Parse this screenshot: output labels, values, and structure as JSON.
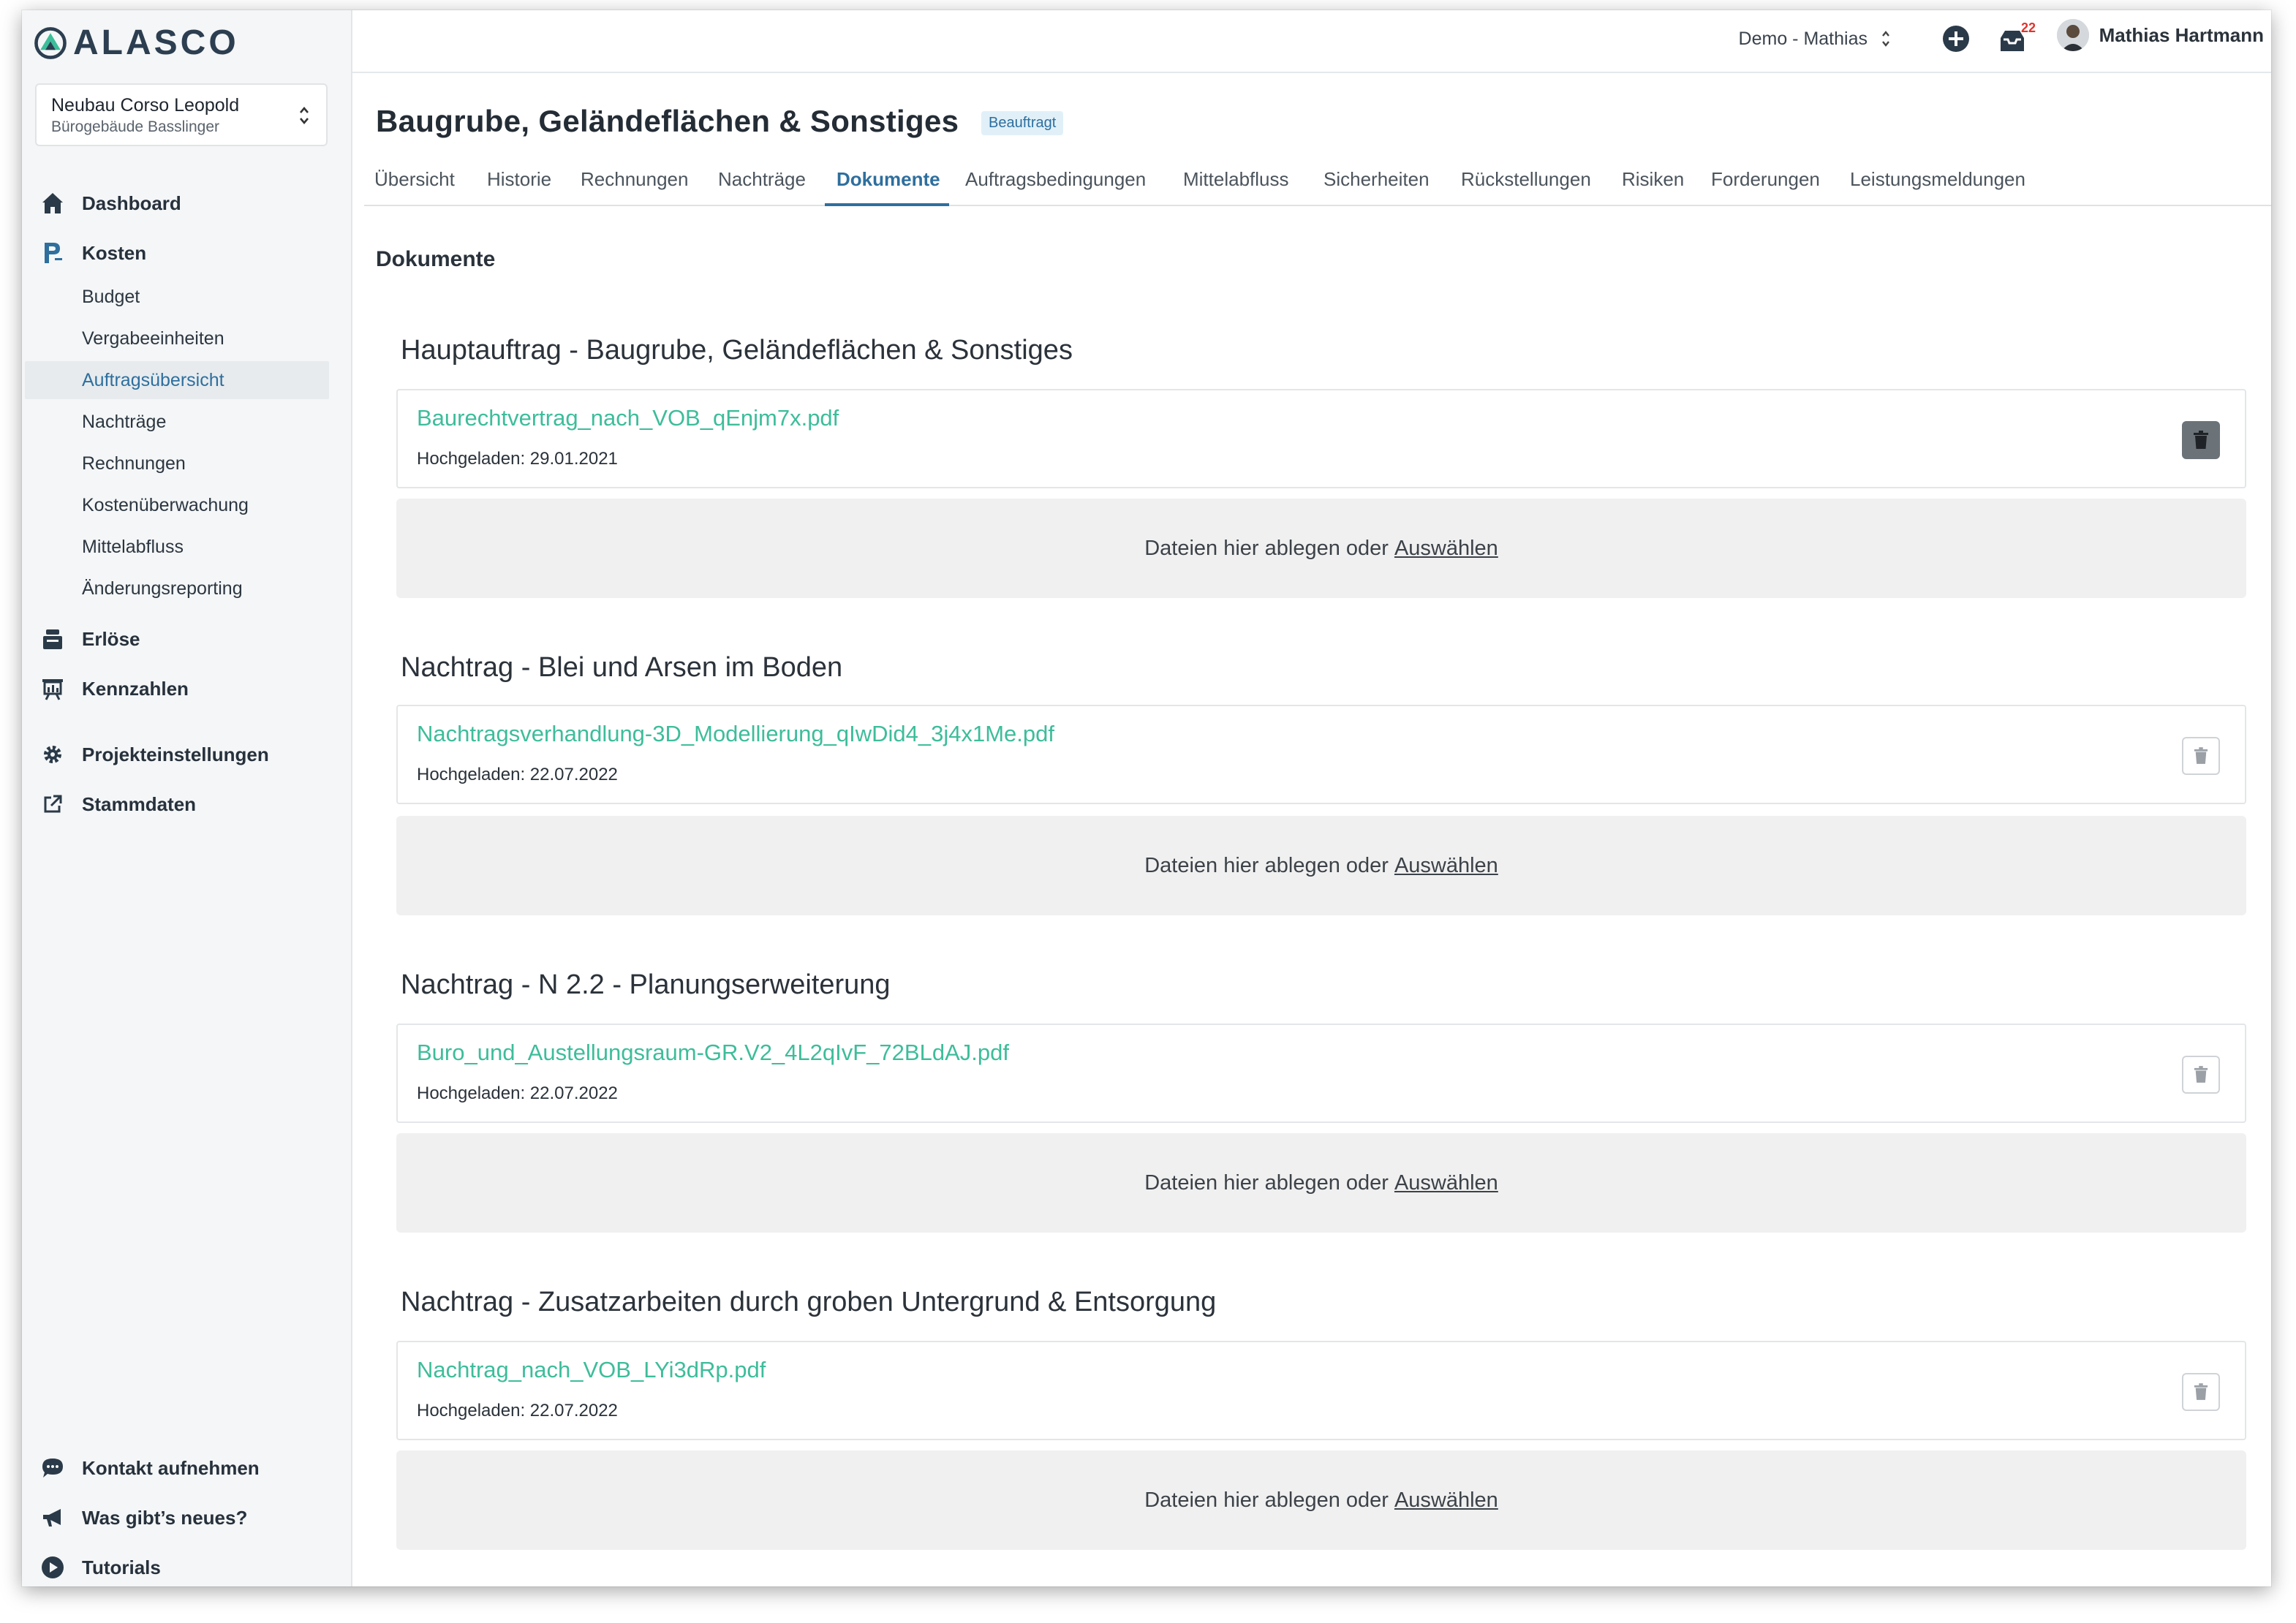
{
  "app": {
    "logo_text": "ALASCO"
  },
  "project": {
    "name": "Neubau Corso Leopold",
    "subtitle": "Bürogebäude Basslinger"
  },
  "sidebar": {
    "nav": [
      {
        "label": "Dashboard",
        "icon": "home-icon"
      },
      {
        "label": "Kosten",
        "icon": "cost-icon"
      },
      {
        "label": "Erlöse",
        "icon": "revenue-icon"
      },
      {
        "label": "Kennzahlen",
        "icon": "chart-icon"
      },
      {
        "label": "Projekteinstellungen",
        "icon": "gear-icon"
      },
      {
        "label": "Stammdaten",
        "icon": "external-link-icon"
      }
    ],
    "cost_sub": [
      {
        "label": "Budget"
      },
      {
        "label": "Vergabeeinheiten"
      },
      {
        "label": "Auftragsübersicht",
        "active": true
      },
      {
        "label": "Nachträge"
      },
      {
        "label": "Rechnungen"
      },
      {
        "label": "Kostenüberwachung"
      },
      {
        "label": "Mittelabfluss"
      },
      {
        "label": "Änderungsreporting"
      }
    ],
    "bottom": [
      {
        "label": "Kontakt aufnehmen",
        "icon": "chat-icon"
      },
      {
        "label": "Was gibt’s neues?",
        "icon": "megaphone-icon"
      },
      {
        "label": "Tutorials",
        "icon": "play-icon"
      }
    ]
  },
  "topbar": {
    "demo_select": "Demo - Mathias",
    "notification_count": "22",
    "user_name": "Mathias Hartmann"
  },
  "page": {
    "title": "Baugrube, Geländeflächen & Sonstiges",
    "status": "Beauftragt",
    "section_heading": "Dokumente",
    "tabs": [
      {
        "label": "Übersicht"
      },
      {
        "label": "Historie"
      },
      {
        "label": "Rechnungen"
      },
      {
        "label": "Nachträge"
      },
      {
        "label": "Dokumente",
        "active": true
      },
      {
        "label": "Auftragsbedingungen"
      },
      {
        "label": "Mittelabfluss"
      },
      {
        "label": "Sicherheiten"
      },
      {
        "label": "Rückstellungen"
      },
      {
        "label": "Risiken"
      },
      {
        "label": "Forderungen"
      },
      {
        "label": "Leistungsmeldungen"
      }
    ],
    "dropzone": {
      "text": "Dateien hier ablegen oder",
      "link": "Auswählen"
    },
    "groups": [
      {
        "title": "Hauptauftrag - Baugrube, Geländeflächen & Sonstiges",
        "file": "Baurechtvertrag_nach_VOB_qEnjm7x.pdf",
        "uploaded": "Hochgeladen: 29.01.2021"
      },
      {
        "title": "Nachtrag - Blei und Arsen im Boden",
        "file": "Nachtragsverhandlung-3D_Modellierung_qIwDid4_3j4x1Me.pdf",
        "uploaded": "Hochgeladen: 22.07.2022"
      },
      {
        "title": "Nachtrag - N 2.2 - Planungserweiterung",
        "file": "Buro_und_Austellungsraum-GR.V2_4L2qIvF_72BLdAJ.pdf",
        "uploaded": "Hochgeladen: 22.07.2022"
      },
      {
        "title": "Nachtrag - Zusatzarbeiten durch groben Untergrund & Entsorgung",
        "file": "Nachtrag_nach_VOB_LYi3dRp.pdf",
        "uploaded": "Hochgeladen: 22.07.2022"
      }
    ]
  },
  "colors": {
    "accent": "#2e6f9e",
    "link": "#3dbd9a",
    "sidebar_bg": "#f4f6f7",
    "badge": "#e0342c"
  }
}
